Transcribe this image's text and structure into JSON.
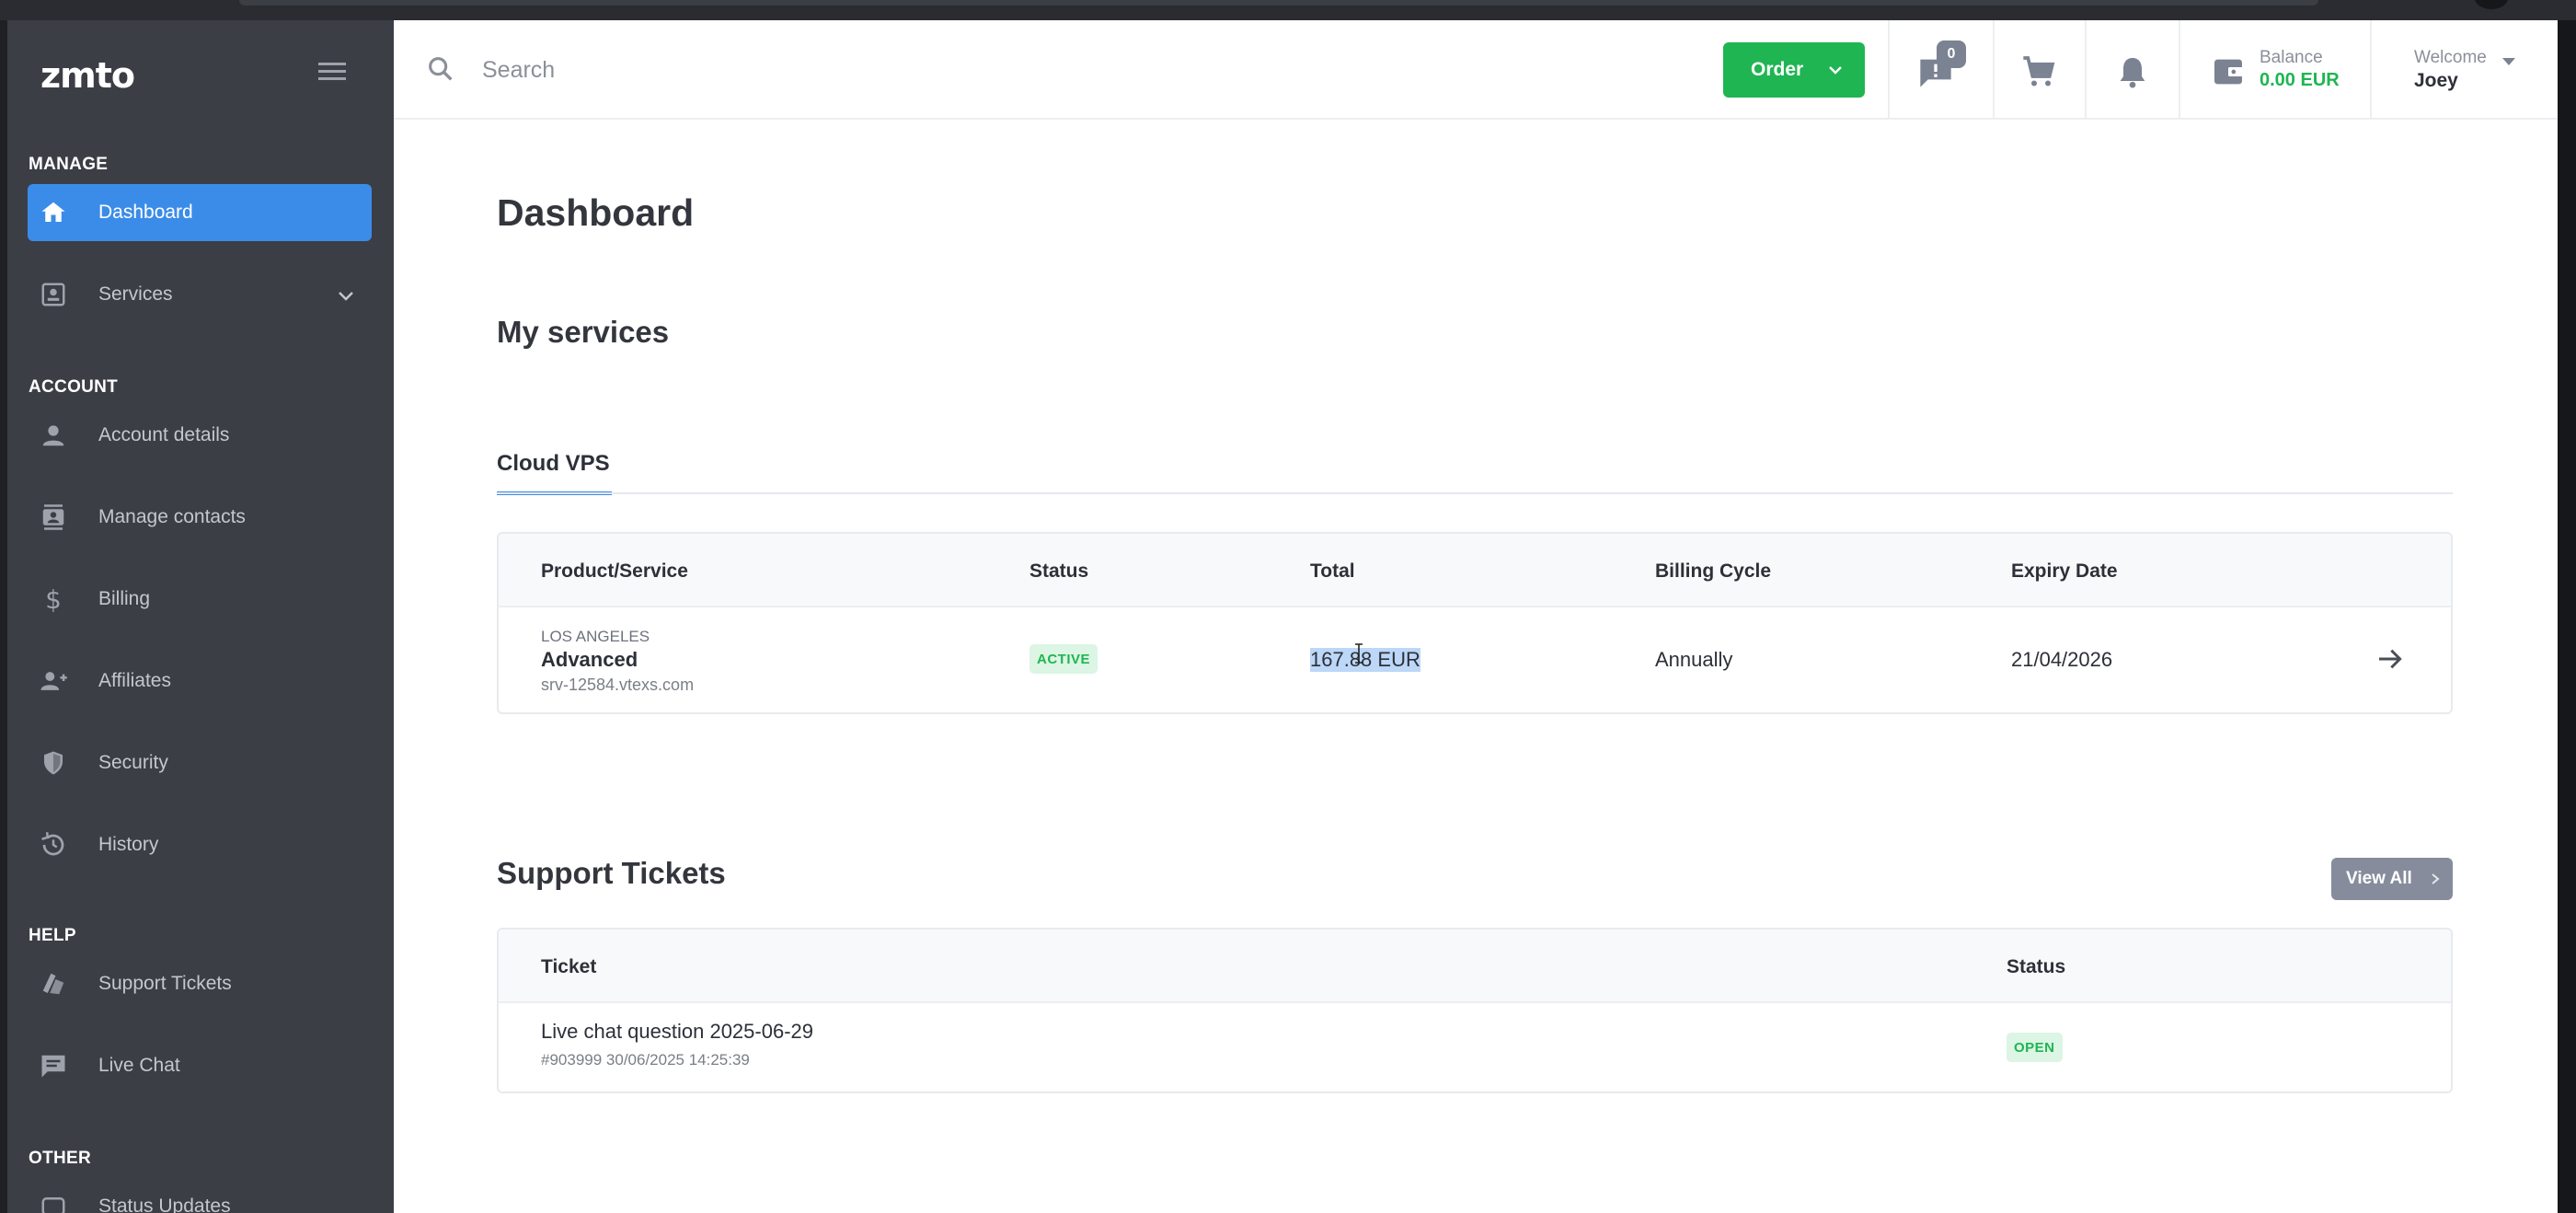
{
  "sidebar": {
    "logo": "zmto",
    "sections": {
      "manage": "MANAGE",
      "account": "ACCOUNT",
      "help": "HELP",
      "other": "OTHER"
    },
    "items": [
      {
        "label": "Dashboard",
        "icon": "home-icon"
      },
      {
        "label": "Services",
        "icon": "services-icon"
      },
      {
        "label": "Account details",
        "icon": "person-icon"
      },
      {
        "label": "Manage contacts",
        "icon": "contacts-icon"
      },
      {
        "label": "Billing",
        "icon": "dollar-icon"
      },
      {
        "label": "Affiliates",
        "icon": "add-user-icon"
      },
      {
        "label": "Security",
        "icon": "shield-icon"
      },
      {
        "label": "History",
        "icon": "history-icon"
      },
      {
        "label": "Support Tickets",
        "icon": "tickets-icon"
      },
      {
        "label": "Live Chat",
        "icon": "chat-icon"
      },
      {
        "label": "Status Updates",
        "icon": "status-icon"
      }
    ]
  },
  "header": {
    "search_placeholder": "Search",
    "order_label": "Order",
    "messages_count": "0",
    "balance_label": "Balance",
    "balance_value": "0.00 EUR",
    "welcome_label": "Welcome",
    "user_name": "Joey"
  },
  "main": {
    "page_title": "Dashboard",
    "services_title": "My services",
    "tab_label": "Cloud VPS",
    "services_table": {
      "headers": [
        "Product/Service",
        "Status",
        "Total",
        "Billing Cycle",
        "Expiry Date"
      ],
      "rows": [
        {
          "location": "LOS ANGELES",
          "product": "Advanced",
          "hostname": "srv-12584.vtexs.com",
          "status": "ACTIVE",
          "total": "167.88 EUR",
          "billing_cycle": "Annually",
          "expiry_date": "21/04/2026"
        }
      ]
    },
    "tickets_title": "Support Tickets",
    "view_all_label": "View All",
    "tickets_table": {
      "headers": [
        "Ticket",
        "Status"
      ],
      "rows": [
        {
          "subject": "Live chat question 2025-06-29",
          "meta": "#903999 30/06/2025 14:25:39",
          "status": "OPEN"
        }
      ]
    }
  },
  "colors": {
    "sidebar_bg": "#3c3e46",
    "accent_blue": "#3b8ce8",
    "accent_green": "#1fb552"
  }
}
